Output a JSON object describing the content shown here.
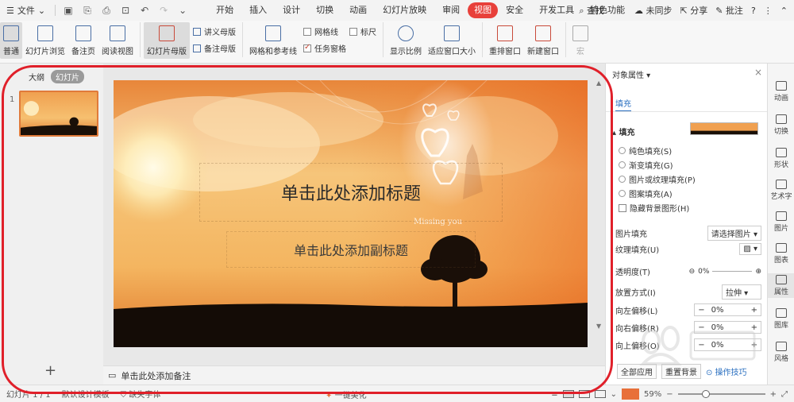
{
  "menubar": {
    "file_label": "文件",
    "tabs": [
      {
        "label": "开始",
        "active": false
      },
      {
        "label": "插入",
        "active": false
      },
      {
        "label": "设计",
        "active": false
      },
      {
        "label": "切换",
        "active": false
      },
      {
        "label": "动画",
        "active": false
      },
      {
        "label": "幻灯片放映",
        "active": false
      },
      {
        "label": "审阅",
        "active": false
      },
      {
        "label": "视图",
        "active": true
      },
      {
        "label": "安全",
        "active": false
      },
      {
        "label": "开发工具",
        "active": false
      },
      {
        "label": "特色功能",
        "active": false
      }
    ],
    "search_label": "查找",
    "sync_label": "未同步",
    "share_label": "分享",
    "comment_label": "批注",
    "accent_color": "#e8403a"
  },
  "ribbon": {
    "normal": "普通",
    "slide_browse": "幻灯片浏览",
    "notes_page": "备注页",
    "reading_view": "阅读视图",
    "slide_master": "幻灯片母版",
    "handout_master": "讲义母版",
    "notes_master": "备注母版",
    "grid_guides": "网格和参考线",
    "gridlines": "网格线",
    "ruler": "标尺",
    "task_pane": "任务窗格",
    "show_ratio": "显示比例",
    "fit_window": "适应窗口大小",
    "rearrange_window": "重排窗口",
    "new_window": "新建窗口",
    "macro": "宏"
  },
  "left_panel": {
    "tab_outline": "大纲",
    "tab_slides": "幻灯片",
    "slide_number": "1",
    "add_icon": "+"
  },
  "slide": {
    "title_placeholder": "单击此处添加标题",
    "subtitle_placeholder": "单击此处添加副标题",
    "decor_text": "Missing you"
  },
  "notes": {
    "placeholder": "单击此处添加备注"
  },
  "right_panel": {
    "header": "对象属性",
    "tab_fill": "填充",
    "fill_section": "填充",
    "options": [
      "纯色填充(S)",
      "渐变填充(G)",
      "图片或纹理填充(P)",
      "图案填充(A)",
      "隐藏背景图形(H)"
    ],
    "picture_fill_label": "图片填充",
    "picture_fill_value": "请选择图片",
    "texture_fill_label": "纹理填充(U)",
    "transparency_label": "透明度(T)",
    "transparency_value": "0%",
    "placement_label": "放置方式(I)",
    "placement_value": "拉伸",
    "offset_left_label": "向左偏移(L)",
    "offset_left_value": "0%",
    "offset_right_label": "向右偏移(R)",
    "offset_right_value": "0%",
    "offset_up_label": "向上偏移(O)",
    "offset_up_value": "0%",
    "apply_all": "全部应用",
    "reset_bg": "重置背景",
    "tips": "操作技巧"
  },
  "icon_strip": [
    "动画",
    "切换",
    "形状",
    "艺术字",
    "图片",
    "图表",
    "属性",
    "图库",
    "风格"
  ],
  "status": {
    "slide_info": "幻灯片 1 / 1",
    "theme": "默认设计模板",
    "missing_fonts": "缺失字体",
    "beautify": "一键美化",
    "zoom": "59%"
  }
}
